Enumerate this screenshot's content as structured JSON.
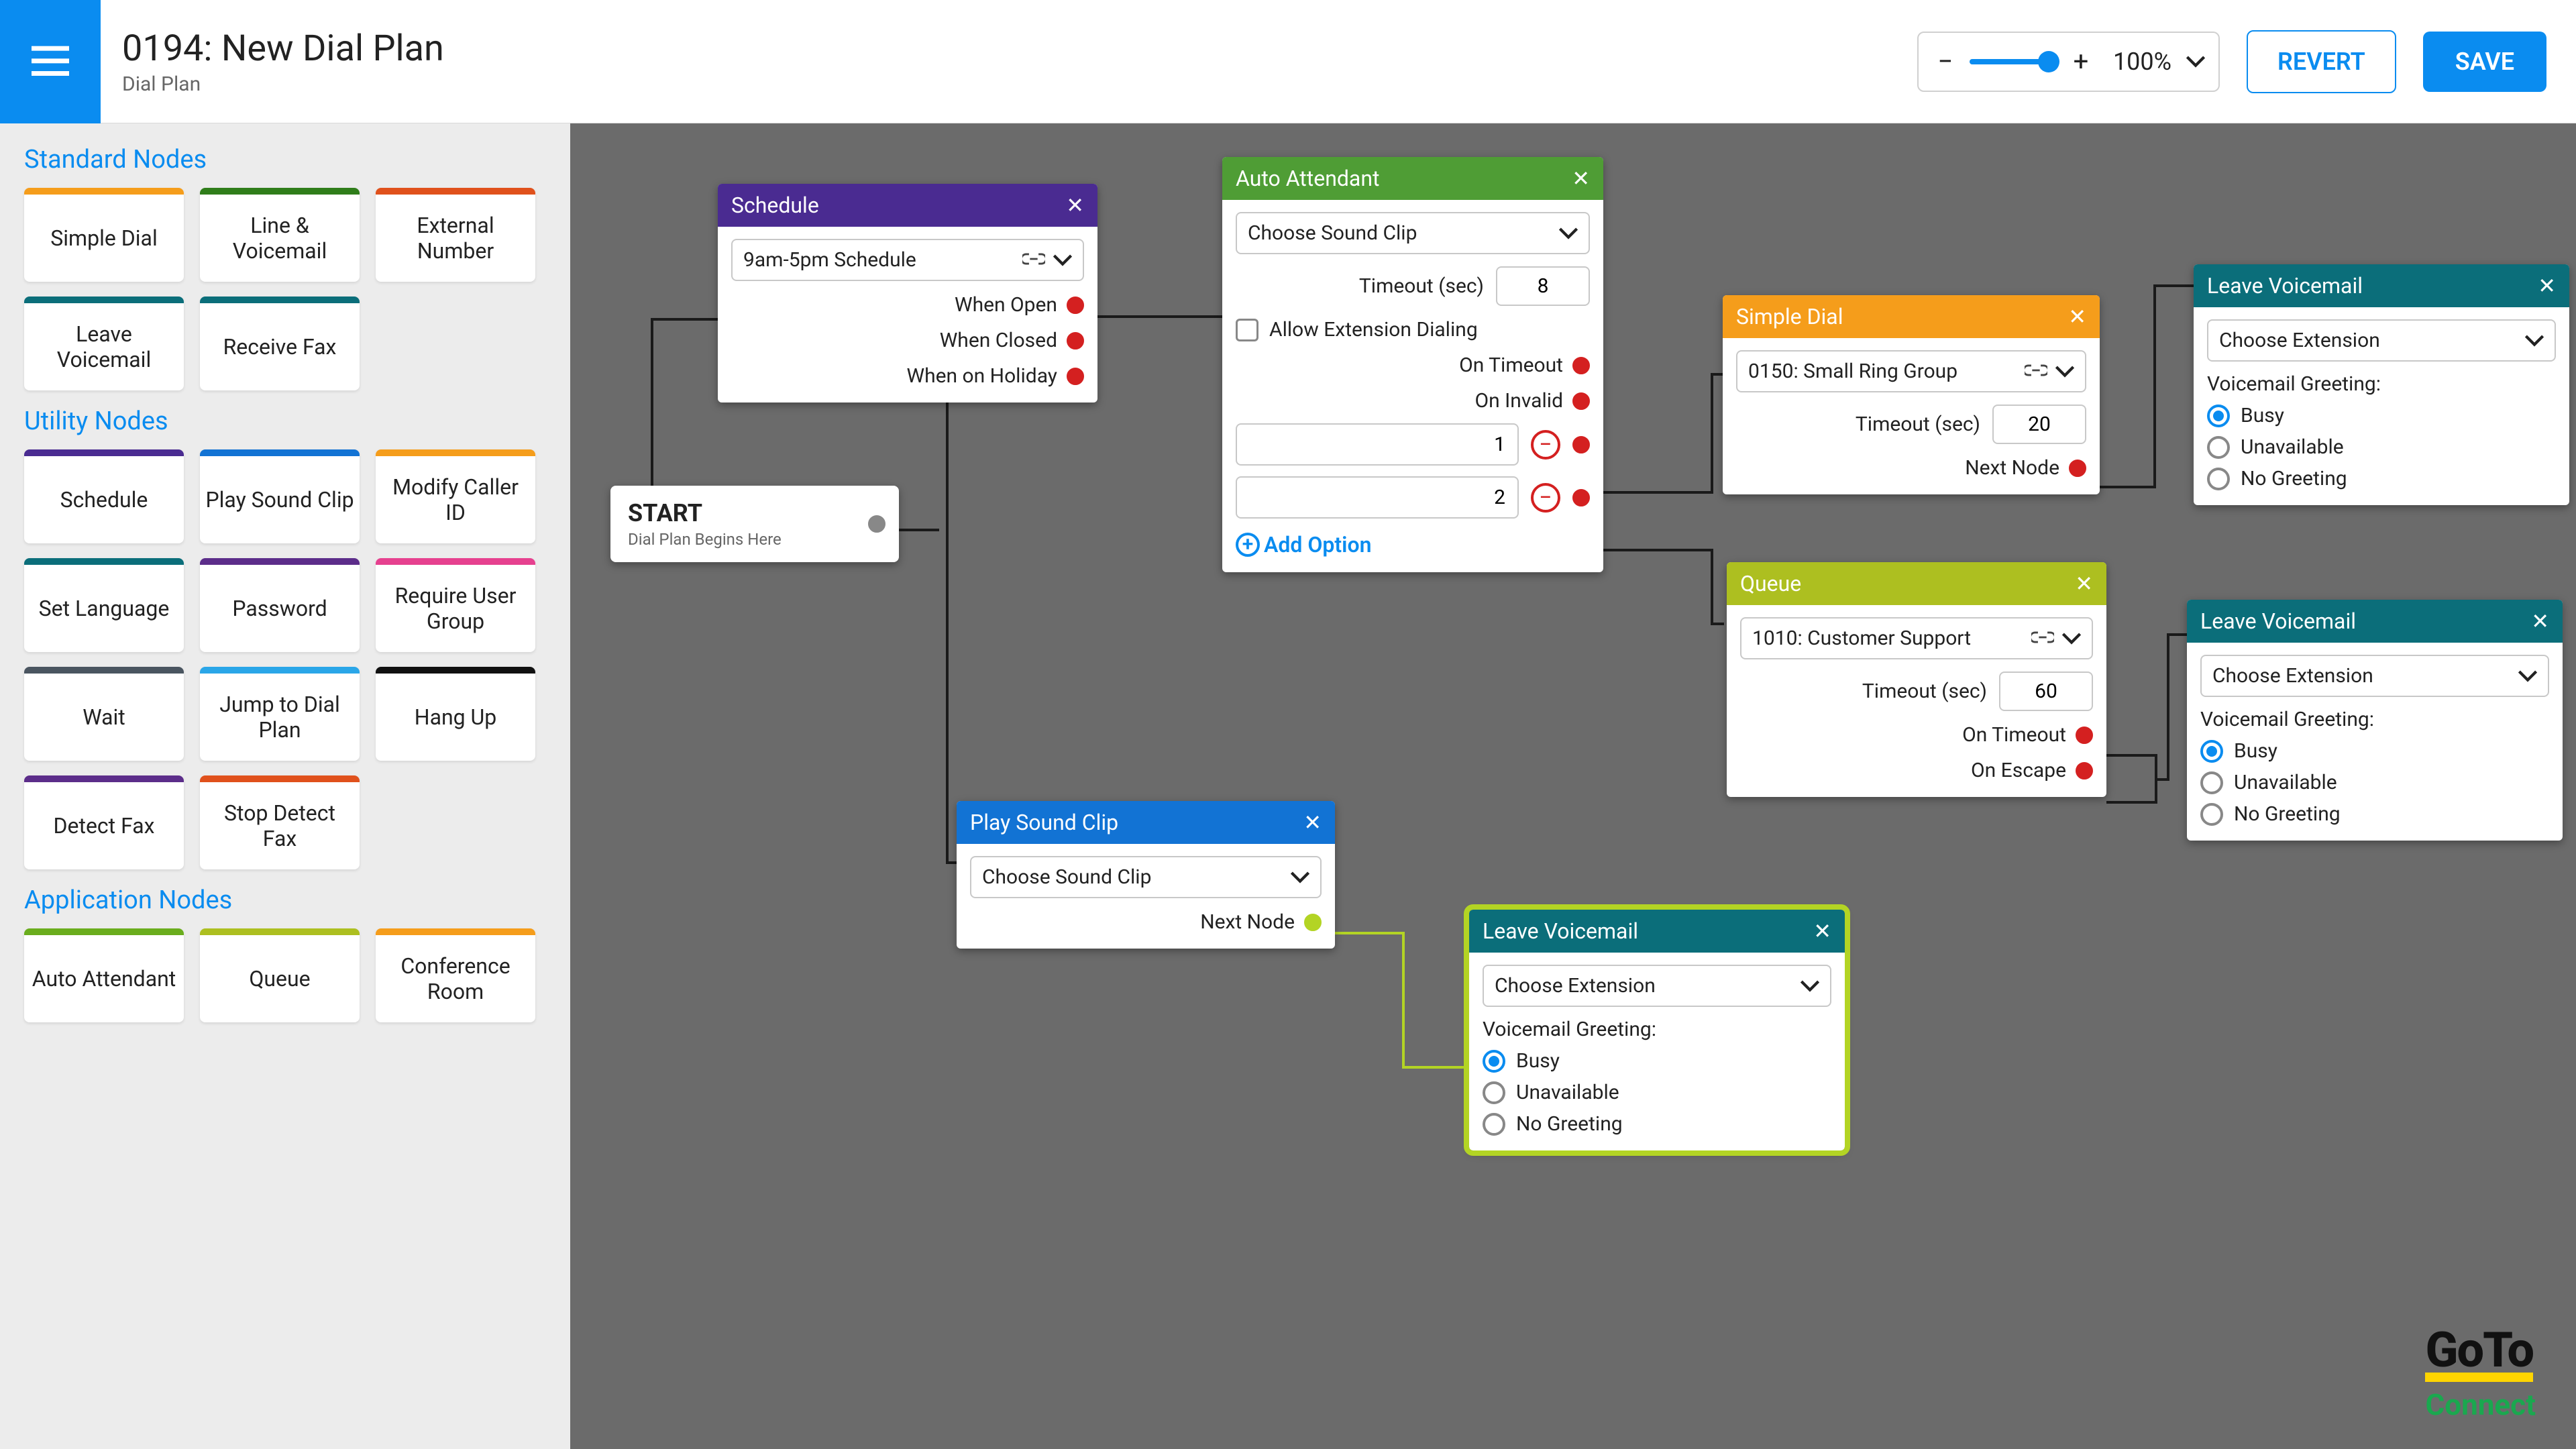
{
  "header": {
    "title": "0194: New Dial Plan",
    "subtitle": "Dial Plan",
    "zoom": "100%",
    "revert": "REVERT",
    "save": "SAVE"
  },
  "sidebar": {
    "sections": {
      "standard": {
        "title": "Standard Nodes",
        "items": [
          "Simple Dial",
          "Line & Voicemail",
          "External Number",
          "Leave Voicemail",
          "Receive Fax"
        ]
      },
      "utility": {
        "title": "Utility Nodes",
        "items": [
          "Schedule",
          "Play Sound Clip",
          "Modify Caller ID",
          "Set Language",
          "Password",
          "Require User Group",
          "Wait",
          "Jump to Dial Plan",
          "Hang Up",
          "Detect Fax",
          "Stop Detect Fax"
        ]
      },
      "application": {
        "title": "Application Nodes",
        "items": [
          "Auto Attendant",
          "Queue",
          "Conference Room"
        ]
      }
    }
  },
  "canvas": {
    "start": {
      "title": "START",
      "sub": "Dial Plan Begins Here"
    },
    "schedule": {
      "title": "Schedule",
      "picker": "9am-5pm Schedule",
      "outs": [
        "When Open",
        "When Closed",
        "When on Holiday"
      ]
    },
    "autoattendant": {
      "title": "Auto Attendant",
      "picker": "Choose Sound Clip",
      "timeout_lbl": "Timeout (sec)",
      "timeout_val": "8",
      "allow_ext": "Allow Extension Dialing",
      "on_timeout": "On Timeout",
      "on_invalid": "On Invalid",
      "opt1": "1",
      "opt2": "2",
      "add": "Add Option"
    },
    "simpledial": {
      "title": "Simple Dial",
      "picker": "0150: Small Ring Group",
      "timeout_lbl": "Timeout (sec)",
      "timeout_val": "20",
      "next": "Next Node"
    },
    "queue": {
      "title": "Queue",
      "picker": "1010: Customer Support",
      "timeout_lbl": "Timeout (sec)",
      "timeout_val": "60",
      "on_timeout": "On Timeout",
      "on_escape": "On Escape"
    },
    "playsound": {
      "title": "Play Sound Clip",
      "picker": "Choose Sound Clip",
      "next": "Next Node"
    },
    "voicemail": {
      "title": "Leave Voicemail",
      "picker": "Choose Extension",
      "greet_lbl": "Voicemail Greeting:",
      "opts": [
        "Busy",
        "Unavailable",
        "No Greeting"
      ]
    }
  },
  "logo": {
    "line1": "GoTo",
    "line2": "Connect"
  }
}
